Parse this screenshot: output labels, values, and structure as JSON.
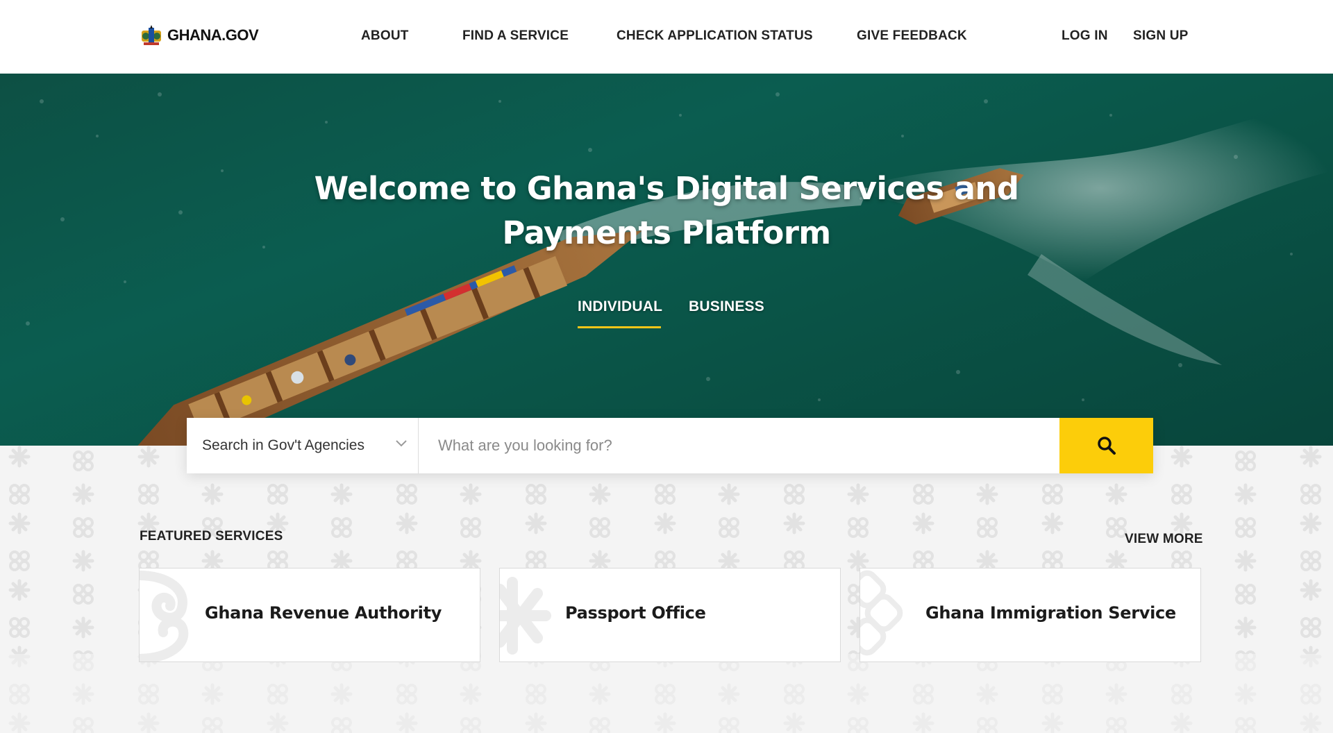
{
  "header": {
    "logo_text": "GHANA.GOV",
    "nav": {
      "about": "ABOUT",
      "find_service": "FIND A SERVICE",
      "check_status": "CHECK APPLICATION STATUS",
      "feedback": "GIVE FEEDBACK",
      "login": "LOG IN",
      "signup": "SIGN UP"
    }
  },
  "hero": {
    "title_line1": "Welcome to Ghana's Digital Services and",
    "title_line2": "Payments Platform",
    "tabs": {
      "individual": "INDIVIDUAL",
      "business": "BUSINESS"
    },
    "active_tab": "INDIVIDUAL"
  },
  "search": {
    "agency_select": "Search in Gov't Agencies",
    "placeholder": "What are you looking for?"
  },
  "featured": {
    "heading": "FEATURED SERVICES",
    "view_more": "VIEW MORE",
    "cards": [
      {
        "label": "Ghana Revenue Authority",
        "icon": "adinkra-swirl-icon"
      },
      {
        "label": "Passport Office",
        "icon": "adinkra-star-icon"
      },
      {
        "label": "Ghana Immigration Service",
        "icon": "adinkra-knot-icon"
      }
    ]
  },
  "colors": {
    "accent_yellow": "#fccd0a",
    "tab_underline": "#f5c518",
    "hero_sea": "#0b5d50"
  }
}
